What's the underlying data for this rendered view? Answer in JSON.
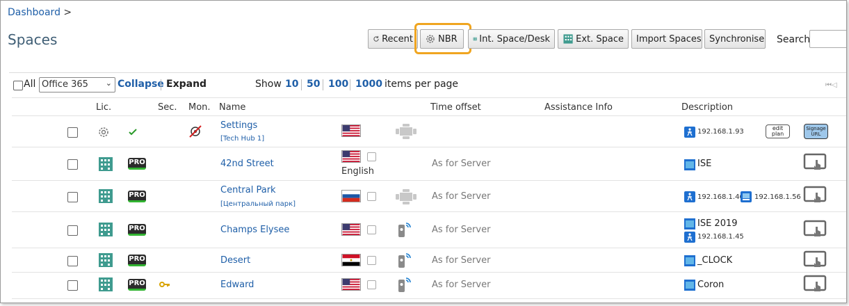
{
  "breadcrumb": {
    "link": "Dashboard",
    "sep": ">"
  },
  "page_title": "Spaces",
  "toolbar": {
    "recent": "Recent",
    "nbr": "NBR",
    "int_space": "Int. Space/Desk",
    "ext_space": "Ext. Space",
    "import": "Import Spaces",
    "sync": "Synchronise",
    "search_label": "Search:",
    "search_value": ""
  },
  "controls": {
    "all_label": "All",
    "filter_value": "Office 365",
    "collapse": "Collapse",
    "expand": "Expand",
    "show_label": "Show",
    "page_sizes": [
      "10",
      "50",
      "100",
      "1000"
    ],
    "per_page_label": "items per page"
  },
  "columns": {
    "lic": "Lic.",
    "sec": "Sec.",
    "mon": "Mon.",
    "name": "Name",
    "time_offset": "Time offset",
    "assistance": "Assistance Info",
    "description": "Description"
  },
  "badges": {
    "pro": "PRO",
    "edit_line1": "edit",
    "edit_line2": "plan",
    "signage_line1": "Signage",
    "signage_line2": "URL"
  },
  "rows": [
    {
      "name": "Settings",
      "sub": "[Tech Hub 1]",
      "flag": "us",
      "time": "",
      "ip1": "192.168.1.93"
    },
    {
      "name": "42nd Street",
      "flag": "us",
      "language": "English",
      "time": "As for Server",
      "desc": "ISE"
    },
    {
      "name": "Central Park",
      "sub": "[Центральный парк]",
      "flag": "ru",
      "time": "As for Server",
      "ip1": "192.168.1.46",
      "ip2": "192.168.1.56"
    },
    {
      "name": "Champs Elysee",
      "flag": "us",
      "time": "As for Server",
      "desc": "ISE 2019",
      "ip1": "192.168.1.45"
    },
    {
      "name": "Desert",
      "flag": "eg",
      "time": "As for Server",
      "desc": "_CLOCK"
    },
    {
      "name": "Edward",
      "flag": "us",
      "time": "As for Server",
      "desc": "Coron"
    }
  ]
}
